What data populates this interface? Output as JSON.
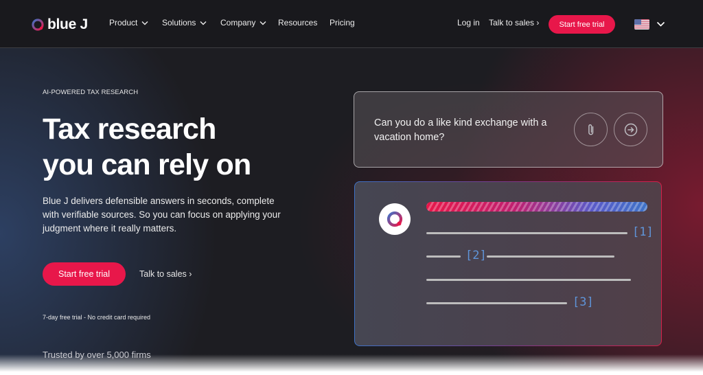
{
  "nav": {
    "brand": "blue J",
    "items": [
      {
        "label": "Product",
        "dropdown": true
      },
      {
        "label": "Solutions",
        "dropdown": true
      },
      {
        "label": "Company",
        "dropdown": true
      },
      {
        "label": "Resources",
        "dropdown": false
      },
      {
        "label": "Pricing",
        "dropdown": false
      }
    ],
    "login": "Log in",
    "talk_to_sales": "Talk to sales ›",
    "cta": "Start free trial",
    "locale_icon": "us-flag-icon"
  },
  "hero": {
    "eyebrow": "AI-POWERED TAX RESEARCH",
    "headline_line1": "Tax research",
    "headline_line2": "you can rely on",
    "description": "Blue J delivers defensible answers in seconds, complete with verifiable sources. So you can focus on applying your judgment where it really matters.",
    "cta_primary": "Start free trial",
    "cta_secondary": "Talk to sales ›",
    "fine_print": "7-day free trial - No credit card required",
    "trusted": "Trusted by over 5,000 firms"
  },
  "demo": {
    "question": "Can you do a like kind exchange with a vacation home?",
    "citations": [
      "[1]",
      "[2]",
      "[3]"
    ]
  },
  "colors": {
    "accent": "#e8174a",
    "brand_blue": "#3e73c8",
    "citation": "#5f95da"
  }
}
